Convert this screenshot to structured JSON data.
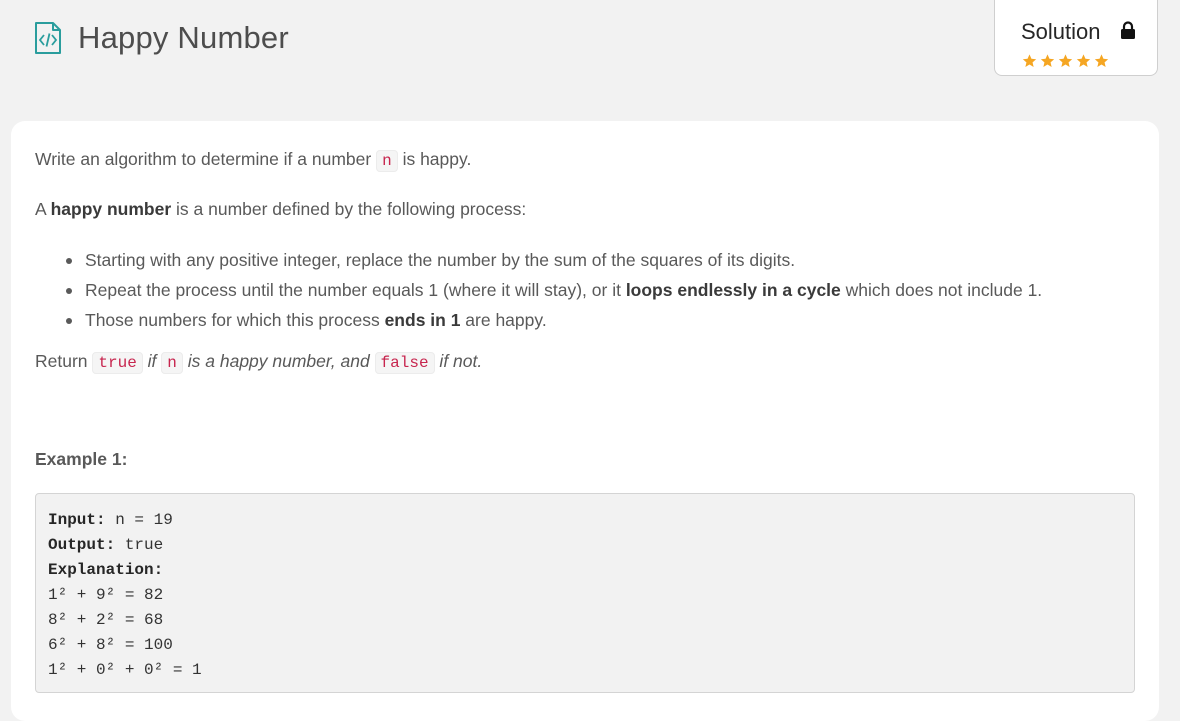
{
  "header": {
    "title": "Happy Number",
    "solution_label": "Solution",
    "rating_stars": 5
  },
  "description": {
    "p1_before": "Write an algorithm to determine if a number ",
    "p1_code": "n",
    "p1_after": " is happy.",
    "p2_before": "A ",
    "p2_bold": "happy number",
    "p2_after": " is a number defined by the following process:",
    "bullets": {
      "b1": "Starting with any positive integer, replace the number by the sum of the squares of its digits.",
      "b2_before": "Repeat the process until the number equals 1 (where it will stay), or it ",
      "b2_bold": "loops endlessly in a cycle",
      "b2_after": " which does not include 1.",
      "b3_before": "Those numbers for which this process ",
      "b3_bold": "ends in 1",
      "b3_after": " are happy."
    },
    "p3_before": "Return ",
    "p3_code1": "true",
    "p3_mid1": " if ",
    "p3_code2": "n",
    "p3_mid2": " is a happy number, and ",
    "p3_code3": "false",
    "p3_after": " if not."
  },
  "example": {
    "title": "Example 1:",
    "input_label": "Input:",
    "input_value": " n = 19",
    "output_label": "Output:",
    "output_value": " true",
    "explanation_label": "Explanation:",
    "lines": [
      "1² + 9² = 82",
      "8² + 2² = 68",
      "6² + 8² = 100",
      "1² + 0² + 0² = 1"
    ]
  },
  "colors": {
    "accent_teal": "#2a9d9d",
    "star_orange": "#f5a623",
    "code_red": "#c7254e"
  }
}
